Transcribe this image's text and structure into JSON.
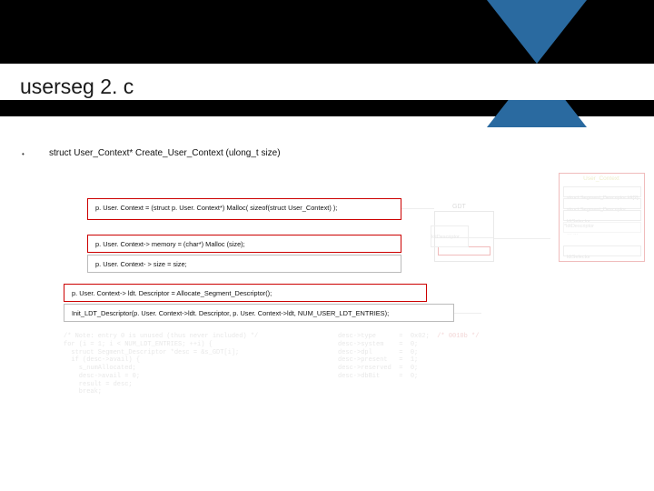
{
  "slide": {
    "title": "userseg 2. c",
    "bullet": "•",
    "signature": "struct User_Context* Create_User_Context (ulong_t size)"
  },
  "code": {
    "line1": "p. User. Context = (struct p. User. Context*)  Malloc( sizeof(struct User_Context) );",
    "line2": "p. User. Context-> memory = (char*) Malloc (size);",
    "line3": "p. User. Context- > size = size;",
    "line4": "p. User. Context-> ldt. Descriptor = Allocate_Segment_Descriptor();",
    "line5": "Init_LDT_Descriptor(p. User. Context->ldt. Descriptor, p. User. Context->ldt, NUM_USER_LDT_ENTRIES);"
  },
  "ghost": {
    "left": "/* Note: entry 0 is unused (thus never included) */\nfor (i = 1; i < NUM_LDT_ENTRIES; ++i) {\n  struct Segment_Descriptor *desc = &s_GDT[i];\n  if (desc->avail) {\n    s_numAllocated;\n    desc->avail = 0;\n    result = desc;\n    break;\n",
    "right_lines": [
      [
        "desc->type",
        "=  0x02;",
        "/* 0010b */"
      ],
      [
        "desc->system",
        "=  0;",
        ""
      ],
      [
        "desc->dpl",
        "=  0;",
        ""
      ],
      [
        "desc->present",
        "=  1;",
        ""
      ],
      [
        "desc->reserved",
        "=  0;",
        ""
      ],
      [
        "desc->dbBit",
        "=  0;",
        ""
      ]
    ]
  },
  "diagram": {
    "uc_title": "User_Context",
    "uc_rows": [
      "struct Segment_Descriptor ldt[2]",
      "struct Segment_Descriptor *ldtDescriptor",
      "ldtSelector",
      "… …",
      "ldtSelector"
    ],
    "gdt_label": "GDT",
    "mid_label": "ldtDescriptor"
  },
  "colors": {
    "red": "#c00000"
  }
}
